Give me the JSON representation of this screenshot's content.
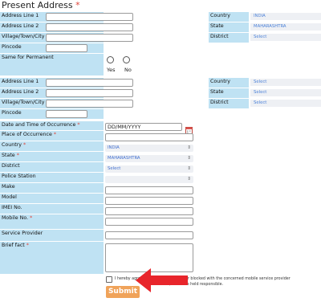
{
  "present_address": {
    "title": "Present Address",
    "required_mark": "*",
    "address_line1_label": "Address Line 1",
    "address_line2_label": "Address Line 2",
    "village_label": "Village/Town/City",
    "pincode_label": "Pincode",
    "country_label": "Country",
    "country_value": "INDIA",
    "state_label": "State",
    "state_value": "MAHARASHTRA",
    "district_label": "District",
    "district_value": "Select"
  },
  "same_for_permanent": {
    "label": "Same for Permanent",
    "yes_label": "Yes",
    "no_label": "No"
  },
  "permanent_address": {
    "address_line1_label": "Address Line 1",
    "address_line2_label": "Address Line 2",
    "village_label": "Village/Town/City",
    "pincode_label": "Pincode",
    "country_label": "Country",
    "country_value": "Select",
    "state_label": "State",
    "state_value": "Select",
    "district_label": "District",
    "district_value": "Select"
  },
  "occurrence": {
    "datetime_label": "Date and Time of Occurrence",
    "datetime_placeholder": "DD/MM/YYYY",
    "place_label": "Place of Occurrence",
    "country_label": "Country",
    "country_value": "INDIA",
    "state_label": "State",
    "state_value": "MAHARASHTRA",
    "district_label": "District",
    "district_value": "Select",
    "police_label": "Police Station",
    "police_value": "",
    "make_label": "Make",
    "model_label": "Model",
    "imei_label": "IMEI No.",
    "mobile_label": "Mobile No.",
    "provider_label": "Service Provider",
    "brief_label": "Brief fact"
  },
  "declaration": {
    "line1_left": "I hereby agree",
    "line1_right": "ber blocked with the concerned mobile service provider",
    "line2_left": "usin",
    "line2_right": "same, I shall be held responsible."
  },
  "submit_label": "Submit",
  "colors": {
    "label_bg": "#bfe2f3",
    "submit_bg": "#f0a35a",
    "arrow": "#e8252b",
    "required": "#e0453a"
  }
}
